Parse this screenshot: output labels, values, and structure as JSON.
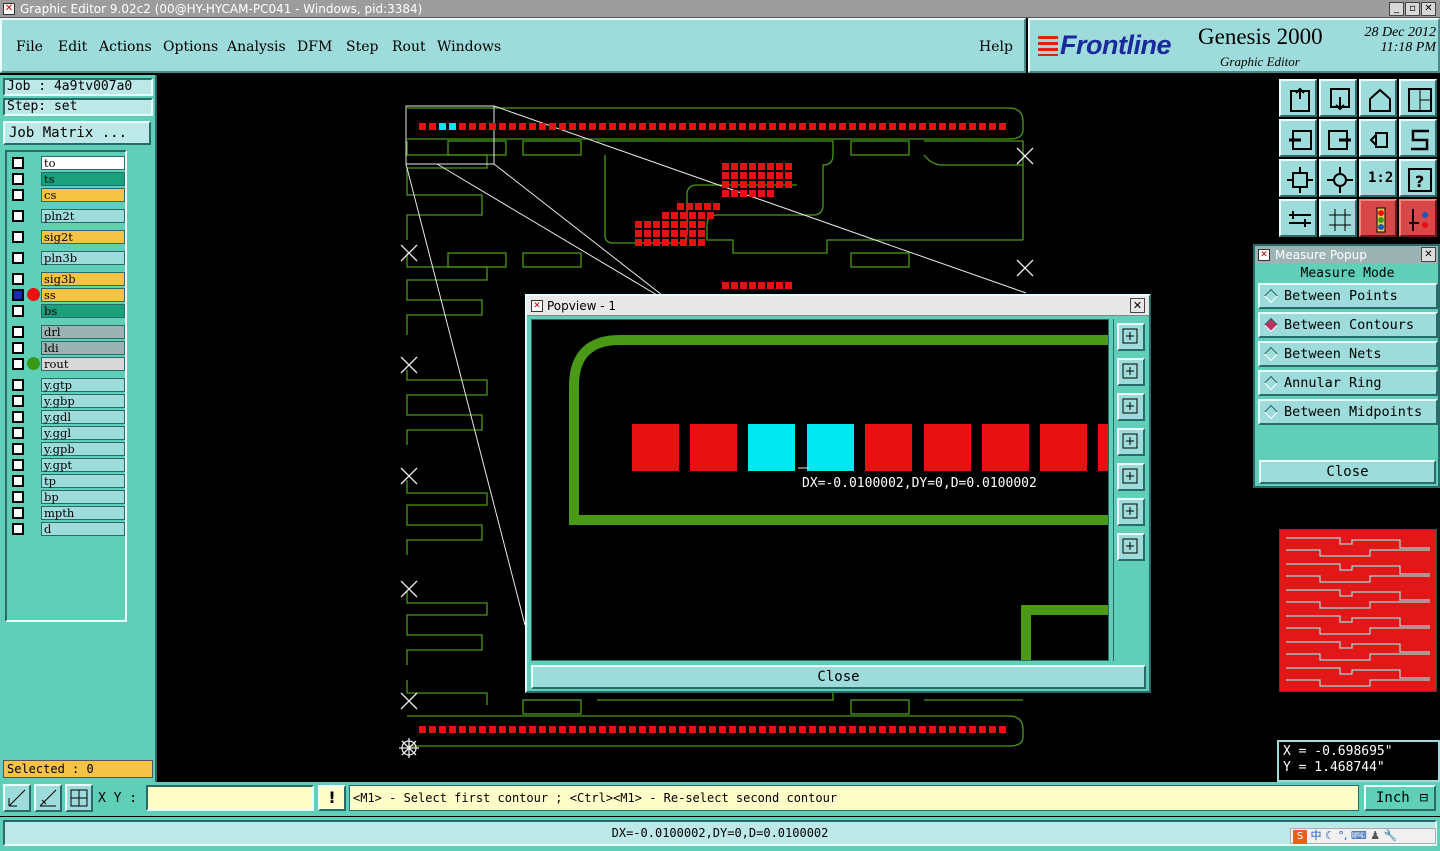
{
  "window": {
    "title": "Graphic Editor 9.02c2 (00@HY-HYCAM-PC041 - Windows, pid:3384)"
  },
  "menu": {
    "items": [
      "File",
      "Edit",
      "Actions",
      "Options",
      "Analysis",
      "DFM",
      "Step",
      "Rout",
      "Windows"
    ],
    "help": "Help"
  },
  "brand": {
    "logo": "Frontline",
    "product": "Genesis 2000",
    "subtitle": "Graphic Editor",
    "date": "28 Dec 2012",
    "time": "11:18 PM"
  },
  "job": {
    "job_label": "Job : 4a9tv007a0",
    "step_label": "Step: set",
    "matrix_button": "Job Matrix ..."
  },
  "layers": [
    {
      "name": "to",
      "color": "#ffffff",
      "dot": ""
    },
    {
      "name": "ts",
      "color": "#1aa07a",
      "dot": ""
    },
    {
      "name": "cs",
      "color": "#f6c344",
      "dot": ""
    },
    {
      "name": "pln2t",
      "color": "#9edcdc",
      "dot": ""
    },
    {
      "name": "sig2t",
      "color": "#f6c344",
      "dot": ""
    },
    {
      "name": "pln3b",
      "color": "#9edcdc",
      "dot": ""
    },
    {
      "name": "sig3b",
      "color": "#f6c344",
      "dot": ""
    },
    {
      "name": "ss",
      "color": "#f6c344",
      "dot": "#e81010"
    },
    {
      "name": "bs",
      "color": "#1aa07a",
      "dot": ""
    },
    {
      "name": "drl",
      "color": "#9cb3b3",
      "dot": ""
    },
    {
      "name": "ldi",
      "color": "#9cb3b3",
      "dot": ""
    },
    {
      "name": "rout",
      "color": "#d8d8d8",
      "dot": "#3a9a18"
    },
    {
      "name": "y.gtp",
      "color": "#9edcdc",
      "dot": ""
    },
    {
      "name": "y.gbp",
      "color": "#9edcdc",
      "dot": ""
    },
    {
      "name": "y.gdl",
      "color": "#9edcdc",
      "dot": ""
    },
    {
      "name": "y.ggl",
      "color": "#9edcdc",
      "dot": ""
    },
    {
      "name": "y.gpb",
      "color": "#9edcdc",
      "dot": ""
    },
    {
      "name": "y.gpt",
      "color": "#9edcdc",
      "dot": ""
    },
    {
      "name": "tp",
      "color": "#9edcdc",
      "dot": ""
    },
    {
      "name": "bp",
      "color": "#9edcdc",
      "dot": ""
    },
    {
      "name": "mpth",
      "color": "#9edcdc",
      "dot": ""
    },
    {
      "name": "d",
      "color": "#9edcdc",
      "dot": ""
    }
  ],
  "selected": "Selected : 0",
  "measure": {
    "title": "Measure Popup",
    "heading": "Measure Mode",
    "options": [
      "Between Points",
      "Between Contours",
      "Between Nets",
      "Annular Ring",
      "Between Midpoints"
    ],
    "active": "Between Contours",
    "close": "Close"
  },
  "popview": {
    "title": "Popview - 1",
    "measurement": "DX=-0.0100002,DY=0,D=0.0100002",
    "close": "Close"
  },
  "coords": {
    "x": "X = -0.698695\"",
    "y": "Y =  1.468744\""
  },
  "toolbar": {
    "icons": [
      "pan-up-icon",
      "pan-down-icon",
      "home-icon",
      "window-icon",
      "pan-left-icon",
      "pan-right-icon",
      "redraw-icon",
      "snap-icon",
      "zoom-fit-icon",
      "zoom-center-icon",
      "scale-1-2-icon",
      "help-icon",
      "tools-icon",
      "grid-icon",
      "layers-up-icon",
      "layers-down-icon"
    ],
    "scale_label": "1:2"
  },
  "bottom": {
    "xy_label": "X Y :",
    "xy_value": "",
    "warn": "!",
    "prompt": "<M1> - Select first contour ; <Ctrl><M1> - Re-select second contour",
    "units": "Inch"
  },
  "status": "DX=-0.0100002,DY=0,D=0.0100002",
  "tray": {
    "ime": "中"
  },
  "colors": {
    "panel": "#5fcfb8",
    "button": "#9edcdc",
    "trace": "#4a9a18",
    "pad": "#e81010",
    "selected_pad": "#00e8f0"
  }
}
